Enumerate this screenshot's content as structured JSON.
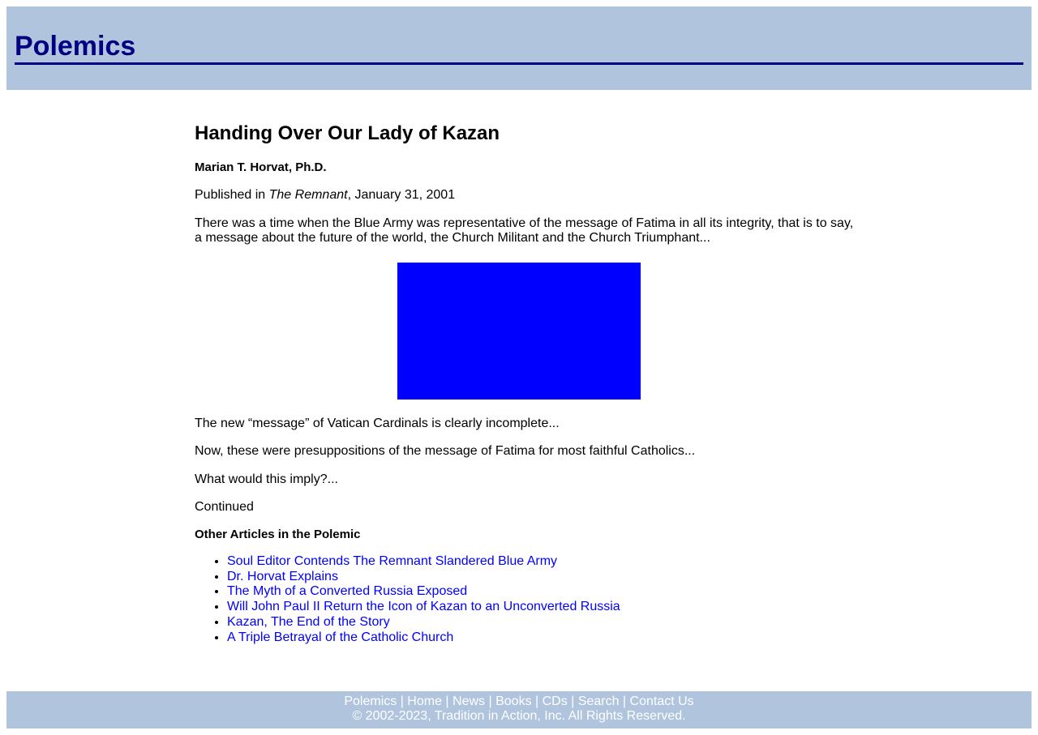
{
  "header": {
    "title": "Polemics"
  },
  "article": {
    "title": "Handing Over Our Lady of Kazan",
    "author": "Marian T. Horvat, Ph.D.",
    "published_prefix": "Published in ",
    "published_source": "The Remnant",
    "published_suffix": ", January 31, 2001",
    "intro": "There was a time when the Blue Army was representative of the message of Fatima in all its integrity, that is to say, a message about the future of the world, the Church Militant and the Church Triumphant...",
    "p1": "The new “message” of Vatican Cardinals is clearly incomplete...",
    "p2": "Now, these were presuppositions of the message of Fatima for most faithful Catholics...",
    "p3": "What would this imply?...",
    "continued": "Continued",
    "other_heading": "Other Articles in the Polemic",
    "links": [
      "Soul Editor Contends The Remnant Slandered Blue Army",
      "Dr. Horvat Explains",
      "The Myth of a Converted Russia Exposed",
      "Will John Paul II Return the Icon of Kazan to an Unconverted Russia",
      "Kazan, The End of the Story",
      "A Triple Betrayal of the Catholic Church"
    ]
  },
  "footer": {
    "nav": [
      "Polemics",
      "Home",
      "News",
      "Books",
      "CDs",
      "Search",
      "Contact Us"
    ],
    "separator": " | ",
    "copyright": "© 2002-2023, Tradition in Action, Inc. All Rights Reserved."
  },
  "colors": {
    "header_bg": "#b0c4de",
    "title": "#000080",
    "link": "#0000ff",
    "image_placeholder": "#0000ff"
  }
}
